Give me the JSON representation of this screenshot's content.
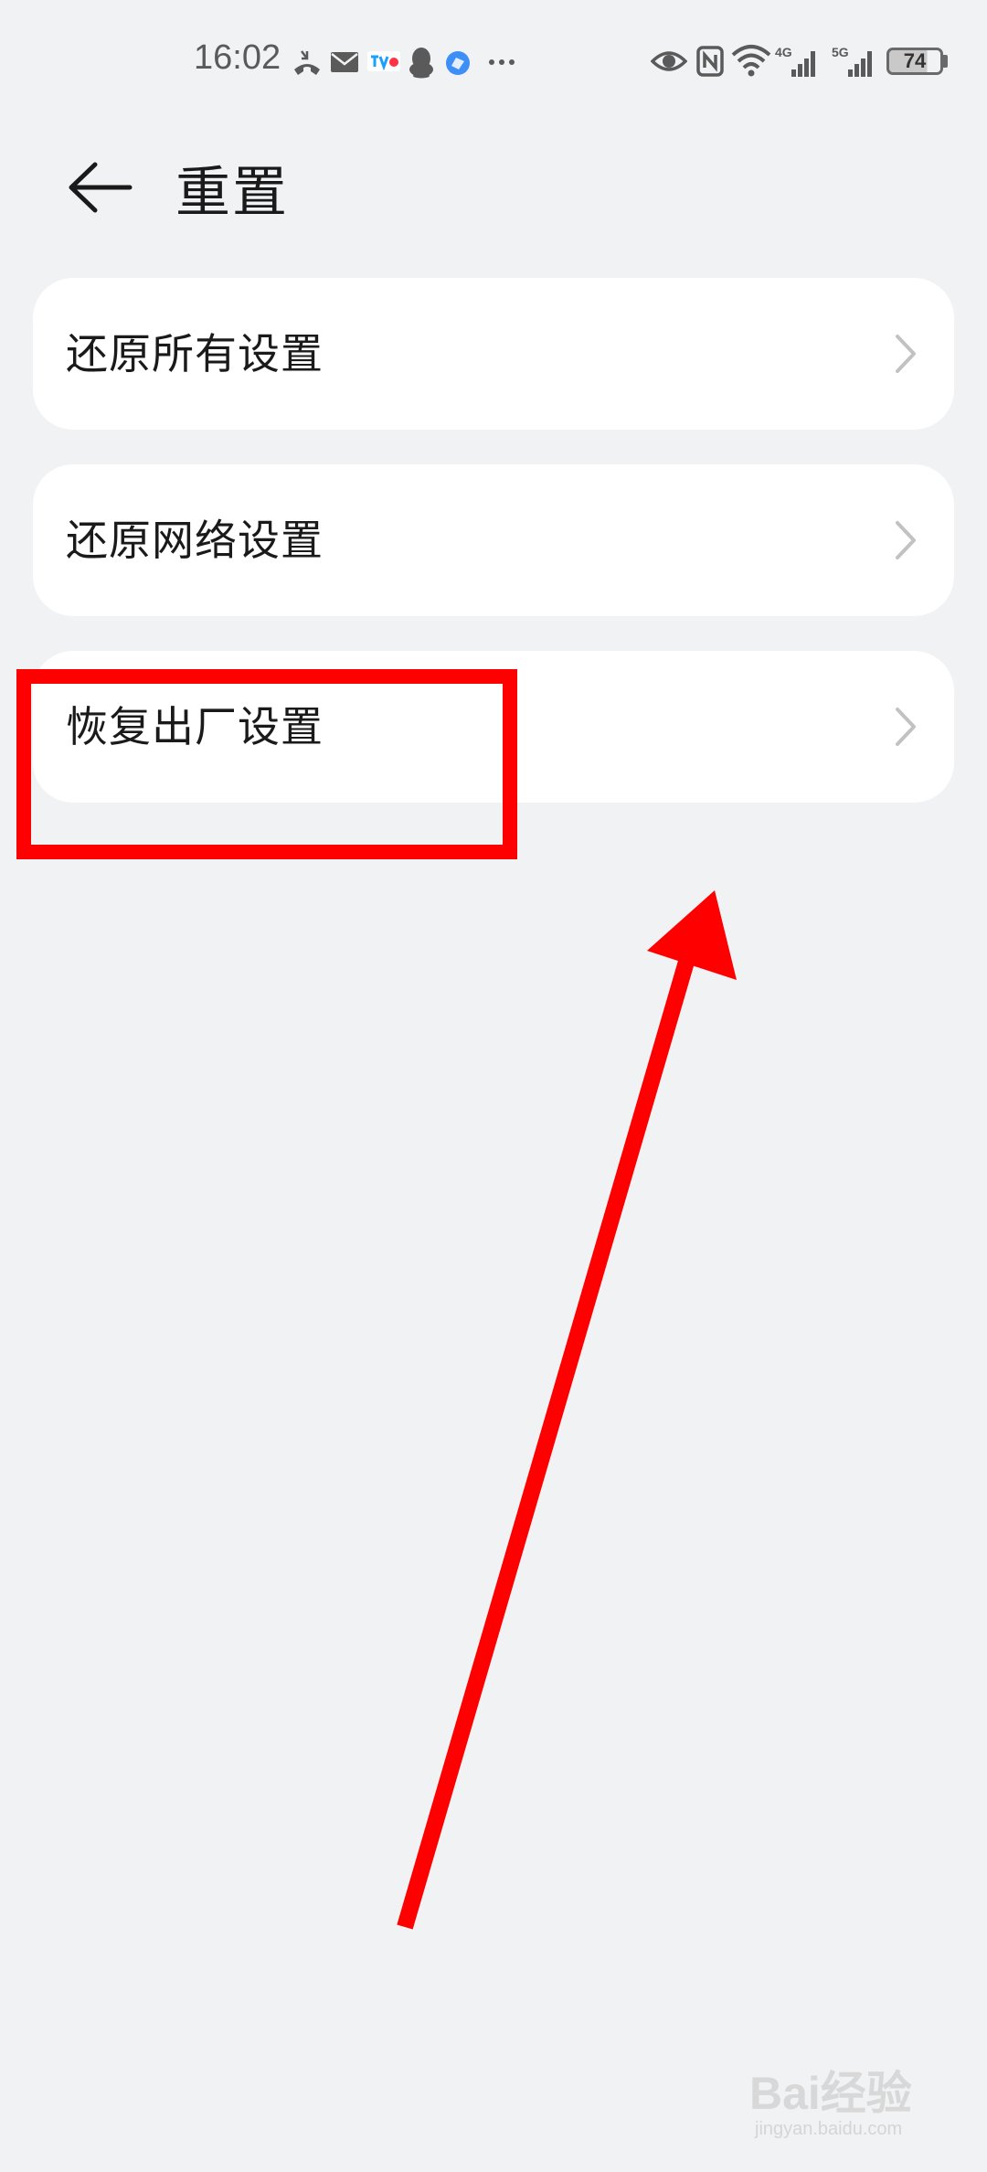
{
  "status_bar": {
    "time": "16:02",
    "battery": "74",
    "network_1": "4G",
    "network_2": "5G",
    "notification_icons": [
      "missed-call-icon",
      "mail-icon",
      "tv-app-icon",
      "qq-icon",
      "browser-icon",
      "more-icon"
    ],
    "system_icons": [
      "eye-comfort-icon",
      "nfc-icon",
      "wifi-icon",
      "signal-4g-icon",
      "signal-5g-icon",
      "battery-icon"
    ]
  },
  "header": {
    "back_icon": "back-arrow-icon",
    "title": "重置"
  },
  "menu": {
    "items": [
      {
        "label": "还原所有设置",
        "icon": "chevron-right-icon"
      },
      {
        "label": "还原网络设置",
        "icon": "chevron-right-icon"
      },
      {
        "label": "恢复出厂设置",
        "icon": "chevron-right-icon"
      }
    ]
  },
  "annotations": {
    "highlight_color": "#ff0000",
    "arrow_color": "#ff0000"
  },
  "watermark": {
    "brand": "Bai经验",
    "url": "jingyan.baidu.com"
  }
}
